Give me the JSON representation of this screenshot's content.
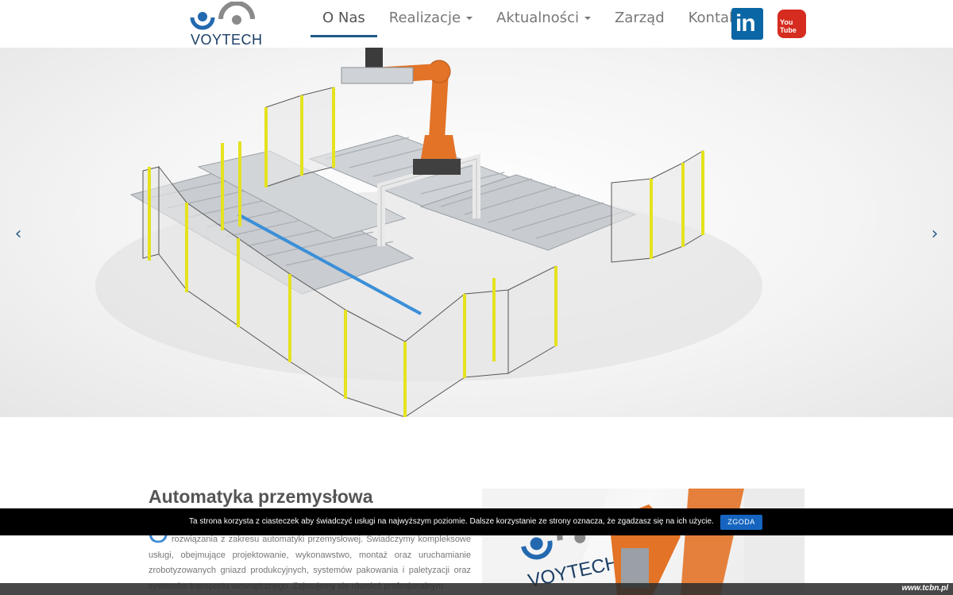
{
  "header": {
    "logo_text": "VOYTECH",
    "nav": [
      {
        "label": "O Nas",
        "active": true,
        "dropdown": false
      },
      {
        "label": "Realizacje",
        "active": false,
        "dropdown": true
      },
      {
        "label": "Aktualności",
        "active": false,
        "dropdown": true
      },
      {
        "label": "Zarząd",
        "active": false,
        "dropdown": false
      },
      {
        "label": "Kontakt",
        "active": false,
        "dropdown": false
      }
    ],
    "social": {
      "linkedin_label": "in",
      "youtube_label": "You Tube"
    }
  },
  "hero": {
    "prev_icon": "‹",
    "next_icon": "›"
  },
  "content": {
    "title": "Automatyka przemysłowa",
    "dropcap": "O",
    "paragraph": "rozwiązania z zakresu automatyki przemysłowej. Świadczymy kompleksowe usługi, obejmujące projektowanie, wykonawstwo, montaż oraz uruchamianie zrobotyzowanych gniazd produkcyjnych, systemów pakowania i paletyzacji oraz systemów transportu wewnętrznego. Zajmujemy się również profesjonalnym"
  },
  "cookie": {
    "text": "Ta strona korzysta z ciasteczek aby świadczyć usługi na najwyższym poziomie. Dalsze korzystanie ze strony oznacza, że zgadzasz się na ich użycie.",
    "button": "ZGODA"
  },
  "watermark": "www.tcbn.pl",
  "colors": {
    "brand": "#1f5a86",
    "accent": "#3e8bd6",
    "robot": "#e27327",
    "fence": "#e5e21f",
    "linkedin": "#0a66a4",
    "youtube": "#d62c1f",
    "cookie_button": "#1565c0"
  }
}
